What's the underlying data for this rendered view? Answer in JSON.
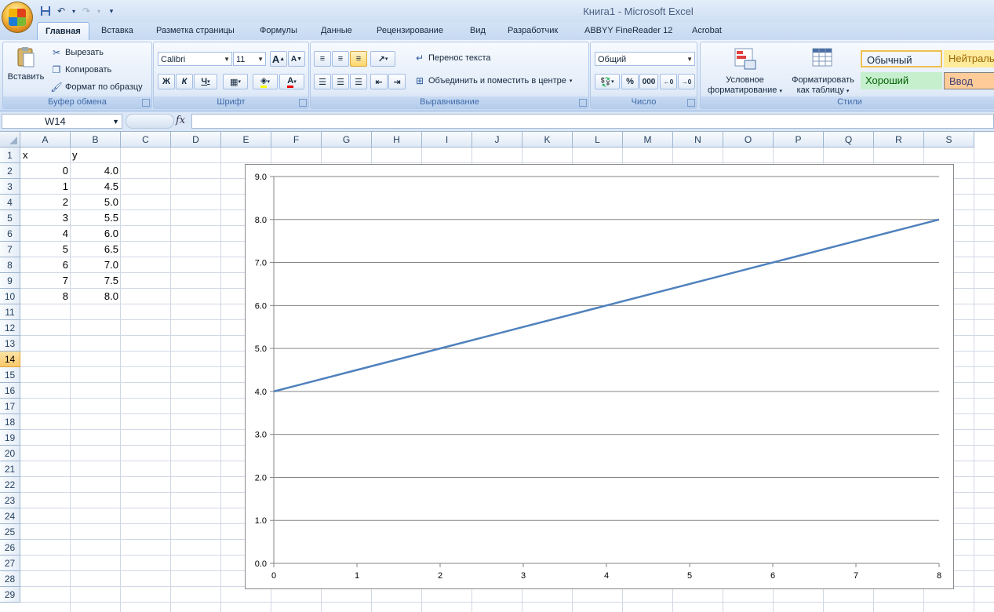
{
  "window": {
    "title": "Книга1  -  Microsoft Excel"
  },
  "quick_access": {
    "icons": [
      "save-icon",
      "undo-icon",
      "redo-icon",
      "customize-icon"
    ]
  },
  "ribbon": {
    "tabs": [
      {
        "label": "Главная",
        "active": true
      },
      {
        "label": "Вставка"
      },
      {
        "label": "Разметка страницы"
      },
      {
        "label": "Формулы"
      },
      {
        "label": "Данные"
      },
      {
        "label": "Рецензирование"
      },
      {
        "label": "Вид"
      },
      {
        "label": "Разработчик"
      },
      {
        "label": "ABBYY FineReader 12"
      },
      {
        "label": "Acrobat"
      }
    ],
    "clipboard": {
      "group_label": "Буфер обмена",
      "paste": "Вставить",
      "cut": "Вырезать",
      "copy": "Копировать",
      "format_painter": "Формат по образцу"
    },
    "font": {
      "group_label": "Шрифт",
      "font_name": "Calibri",
      "font_size": "11",
      "bold": "Ж",
      "italic": "К",
      "underline": "Ч",
      "grow": "A",
      "shrink": "A",
      "font_color_letter": "A"
    },
    "alignment": {
      "group_label": "Выравнивание",
      "wrap_text": "Перенос текста",
      "merge_center": "Объединить и поместить в центре"
    },
    "number": {
      "group_label": "Число",
      "format": "Общий",
      "percent": "%",
      "thousands": "000"
    },
    "styles": {
      "group_label": "Стили",
      "conditional_formatting_line1": "Условное",
      "conditional_formatting_line2": "форматирование",
      "format_as_table_line1": "Форматировать",
      "format_as_table_line2": "как таблицу",
      "cells": [
        {
          "label": "Обычный",
          "bg": "#ffffff",
          "fg": "#000000"
        },
        {
          "label": "Нейтраль",
          "bg": "#ffeb9c",
          "fg": "#9c6500"
        },
        {
          "label": "Хороший",
          "bg": "#c6efce",
          "fg": "#006100"
        },
        {
          "label": "Ввод",
          "bg": "#ffcc99",
          "fg": "#3f3f76"
        }
      ]
    }
  },
  "formula_bar": {
    "name_box": "W14",
    "fx": "fx",
    "content": ""
  },
  "sheet": {
    "columns": [
      "A",
      "B",
      "C",
      "D",
      "E",
      "F",
      "G",
      "H",
      "I",
      "J",
      "K",
      "L",
      "M",
      "N",
      "O",
      "P",
      "Q",
      "R",
      "S"
    ],
    "rows": [
      "1",
      "2",
      "3",
      "4",
      "5",
      "6",
      "7",
      "8",
      "9",
      "10",
      "11",
      "12",
      "13",
      "14",
      "15",
      "16",
      "17",
      "18",
      "19",
      "20",
      "21",
      "22",
      "23",
      "24",
      "25",
      "26",
      "27",
      "28",
      "29"
    ],
    "selected_row": "14",
    "header": {
      "a": "x",
      "b": "y"
    },
    "data": [
      {
        "a": "0",
        "b": "4.0"
      },
      {
        "a": "1",
        "b": "4.5"
      },
      {
        "a": "2",
        "b": "5.0"
      },
      {
        "a": "3",
        "b": "5.5"
      },
      {
        "a": "4",
        "b": "6.0"
      },
      {
        "a": "5",
        "b": "6.5"
      },
      {
        "a": "6",
        "b": "7.0"
      },
      {
        "a": "7",
        "b": "7.5"
      },
      {
        "a": "8",
        "b": "8.0"
      }
    ]
  },
  "chart_data": {
    "type": "line",
    "title": "",
    "xlabel": "",
    "ylabel": "",
    "x": [
      0,
      1,
      2,
      3,
      4,
      5,
      6,
      7,
      8
    ],
    "series": [
      {
        "values": [
          4.0,
          4.5,
          5.0,
          5.5,
          6.0,
          6.5,
          7.0,
          7.5,
          8.0
        ],
        "color": "#4f81bd"
      }
    ],
    "xlim": [
      0,
      8
    ],
    "ylim": [
      0.0,
      9.0
    ],
    "y_ticks": [
      "0.0",
      "1.0",
      "2.0",
      "3.0",
      "4.0",
      "5.0",
      "6.0",
      "7.0",
      "8.0",
      "9.0"
    ],
    "x_ticks": [
      "0",
      "1",
      "2",
      "3",
      "4",
      "5",
      "6",
      "7",
      "8"
    ],
    "grid": "horizontal",
    "legend": "none"
  }
}
